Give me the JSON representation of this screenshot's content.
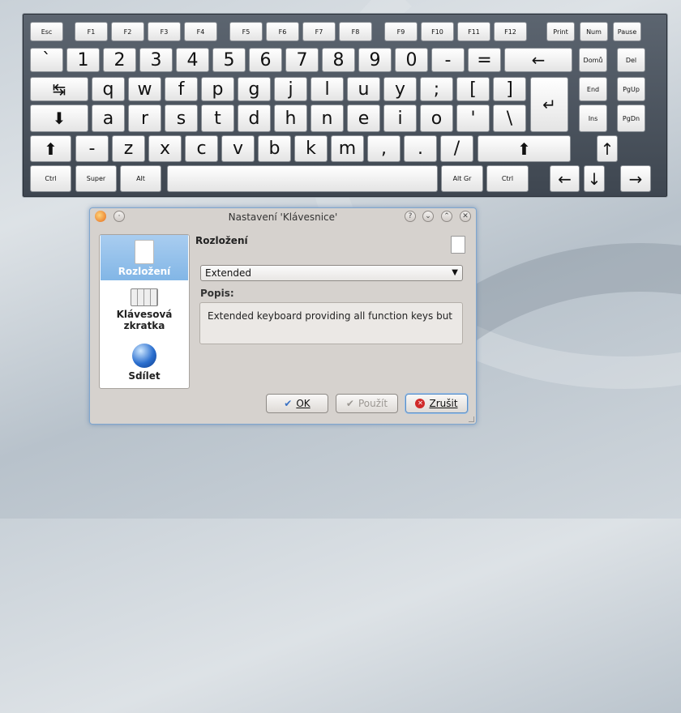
{
  "keyboard": {
    "rows": [
      [
        {
          "label": "Esc",
          "s": 1
        },
        {
          "label": "F1",
          "s": 1
        },
        {
          "label": "F2",
          "s": 1
        },
        {
          "label": "F3",
          "s": 1
        },
        {
          "label": "F4",
          "s": 1
        },
        {
          "label": "F5",
          "s": 1
        },
        {
          "label": "F6",
          "s": 1
        },
        {
          "label": "F7",
          "s": 1
        },
        {
          "label": "F8",
          "s": 1
        },
        {
          "label": "F9",
          "s": 1
        },
        {
          "label": "F10",
          "s": 1
        },
        {
          "label": "F11",
          "s": 1
        },
        {
          "label": "F12",
          "s": 1
        },
        {
          "label": "Print",
          "s": 1
        },
        {
          "label": "Num",
          "s": 1
        },
        {
          "label": "Pause",
          "s": 1
        }
      ],
      [
        {
          "label": "`"
        },
        {
          "label": "1"
        },
        {
          "label": "2"
        },
        {
          "label": "3"
        },
        {
          "label": "4"
        },
        {
          "label": "5"
        },
        {
          "label": "6"
        },
        {
          "label": "7"
        },
        {
          "label": "8"
        },
        {
          "label": "9"
        },
        {
          "label": "0"
        },
        {
          "label": "-"
        },
        {
          "label": "="
        },
        {
          "label": "←",
          "name": "backspace"
        },
        {
          "label": "Domů",
          "s": 1
        },
        {
          "label": "Del",
          "s": 1
        }
      ],
      [
        {
          "label": "↹",
          "name": "tab"
        },
        {
          "label": "q"
        },
        {
          "label": "w"
        },
        {
          "label": "f"
        },
        {
          "label": "p"
        },
        {
          "label": "g"
        },
        {
          "label": "j"
        },
        {
          "label": "l"
        },
        {
          "label": "u"
        },
        {
          "label": "y"
        },
        {
          "label": ";"
        },
        {
          "label": "["
        },
        {
          "label": "]"
        },
        {
          "label": "↵",
          "name": "enter"
        },
        {
          "label": "End",
          "s": 1
        },
        {
          "label": "PgUp",
          "s": 1
        }
      ],
      [
        {
          "label": "⬇",
          "name": "caps"
        },
        {
          "label": "a"
        },
        {
          "label": "r"
        },
        {
          "label": "s"
        },
        {
          "label": "t"
        },
        {
          "label": "d"
        },
        {
          "label": "h"
        },
        {
          "label": "n"
        },
        {
          "label": "e"
        },
        {
          "label": "i"
        },
        {
          "label": "o"
        },
        {
          "label": "'"
        },
        {
          "label": "\\"
        },
        {
          "label": "Ins",
          "s": 1
        },
        {
          "label": "PgDn",
          "s": 1
        }
      ],
      [
        {
          "label": "⬆",
          "name": "shift-left"
        },
        {
          "label": "-"
        },
        {
          "label": "z"
        },
        {
          "label": "x"
        },
        {
          "label": "c"
        },
        {
          "label": "v"
        },
        {
          "label": "b"
        },
        {
          "label": "k"
        },
        {
          "label": "m"
        },
        {
          "label": ","
        },
        {
          "label": "."
        },
        {
          "label": "/"
        },
        {
          "label": "⬆",
          "name": "shift-right"
        },
        {
          "label": "↑",
          "name": "arrow-up"
        }
      ],
      [
        {
          "label": "Ctrl",
          "s": 1
        },
        {
          "label": "Super",
          "s": 1
        },
        {
          "label": "Alt",
          "s": 1
        },
        {
          "label": "",
          "name": "space"
        },
        {
          "label": "Alt Gr",
          "s": 1
        },
        {
          "label": "Ctrl",
          "s": 1
        },
        {
          "label": "←",
          "name": "arrow-left"
        },
        {
          "label": "↓",
          "name": "arrow-down"
        },
        {
          "label": "→",
          "name": "arrow-right"
        }
      ]
    ]
  },
  "dialog": {
    "title": "Nastavení 'Klávesnice'",
    "sidebar": [
      {
        "label": "Rozložení",
        "icon": "document-icon",
        "selected": true
      },
      {
        "label": "Klávesová zkratka",
        "icon": "keyboard-shortcut-icon",
        "selected": false
      },
      {
        "label": "Sdílet",
        "icon": "globe-icon",
        "selected": false
      }
    ],
    "page_title": "Rozložení",
    "layout_select": "Extended",
    "description_label": "Popis:",
    "description": "Extended keyboard providing all function keys but",
    "buttons": {
      "ok": "OK",
      "apply": "Použít",
      "cancel": "Zrušit"
    }
  }
}
